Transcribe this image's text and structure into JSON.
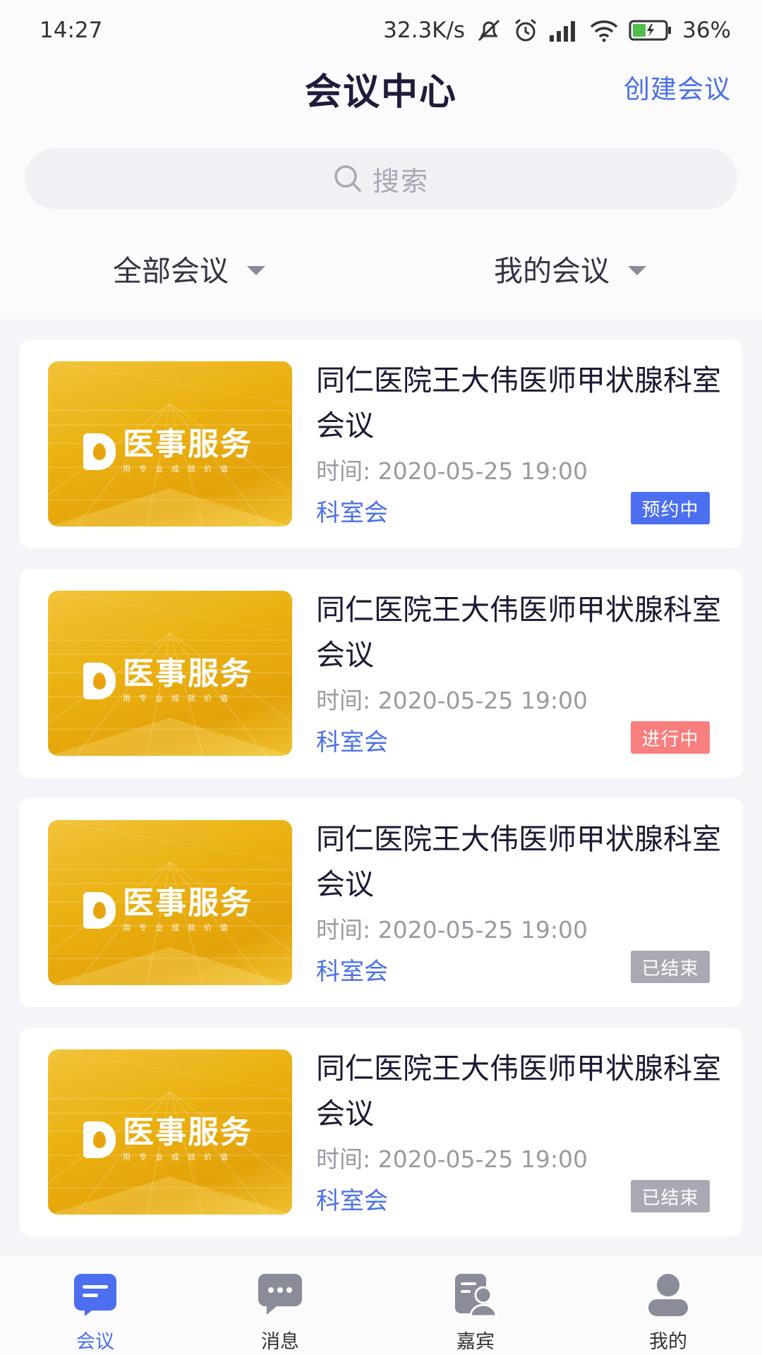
{
  "status_bar": {
    "time": "14:27",
    "net_speed": "32.3K/s",
    "battery": "36%"
  },
  "header": {
    "title": "会议中心",
    "create_label": "创建会议"
  },
  "search": {
    "placeholder": "搜索"
  },
  "filters": [
    {
      "label": "全部会议"
    },
    {
      "label": "我的会议"
    }
  ],
  "thumbnail": {
    "logo_text": "医事服务",
    "logo_sub": "用专业成就价值"
  },
  "meetings": [
    {
      "title": "同仁医院王大伟医师甲状腺科室会议",
      "time": "时间: 2020-05-25 19:00",
      "category": "科室会",
      "status": "预约中",
      "status_color": "#4b6ff0"
    },
    {
      "title": "同仁医院王大伟医师甲状腺科室会议",
      "time": "时间: 2020-05-25 19:00",
      "category": "科室会",
      "status": "进行中",
      "status_color": "#f97e7e"
    },
    {
      "title": "同仁医院王大伟医师甲状腺科室会议",
      "time": "时间: 2020-05-25 19:00",
      "category": "科室会",
      "status": "已结束",
      "status_color": "#a9a9b3"
    },
    {
      "title": "同仁医院王大伟医师甲状腺科室会议",
      "time": "时间: 2020-05-25 19:00",
      "category": "科室会",
      "status": "已结束",
      "status_color": "#a9a9b3"
    }
  ],
  "tabbar": {
    "active_color": "#4b6ff0",
    "inactive_color": "#8a8c9a",
    "items": [
      {
        "label": "会议",
        "icon": "meeting-icon",
        "active": true
      },
      {
        "label": "消息",
        "icon": "message-icon",
        "active": false
      },
      {
        "label": "嘉宾",
        "icon": "guest-icon",
        "active": false
      },
      {
        "label": "我的",
        "icon": "profile-icon",
        "active": false
      }
    ]
  }
}
